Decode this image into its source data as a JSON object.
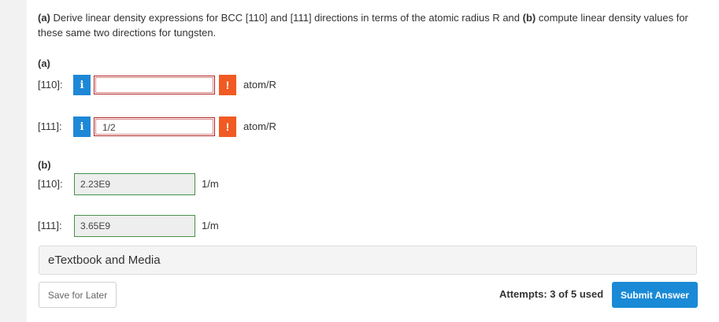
{
  "question": {
    "part_a_marker": "(a)",
    "part_a_text": " Derive linear density expressions for BCC [110] and [111] directions in terms of the atomic radius R and ",
    "part_b_marker": "(b)",
    "part_b_text": " compute linear density values for these same two directions for tungsten."
  },
  "part_a": {
    "label": "(a)",
    "rows": [
      {
        "direction": "[110]:",
        "info_icon": "i",
        "value": "",
        "warning_icon": "!",
        "unit": "atom/R"
      },
      {
        "direction": "[111]:",
        "info_icon": "i",
        "value": "1/2",
        "warning_icon": "!",
        "unit": "atom/R"
      }
    ]
  },
  "part_b": {
    "label": "(b)",
    "rows": [
      {
        "direction": "[110]:",
        "value": "2.23E9",
        "unit": "1/m"
      },
      {
        "direction": "[111]:",
        "value": "3.65E9",
        "unit": "1/m"
      }
    ]
  },
  "etextbook": {
    "label": "eTextbook and Media"
  },
  "footer": {
    "save_label": "Save for Later",
    "attempts_text": "Attempts: 3 of 5 used",
    "submit_label": "Submit Answer"
  },
  "colors": {
    "info_blue": "#1e88d6",
    "warning_orange": "#f15a22",
    "error_border": "#b22222",
    "correct_border": "#4a8f4a",
    "submit_blue": "#1a8ad6"
  },
  "icons": {
    "info": "info-icon",
    "warning": "warning-icon"
  }
}
